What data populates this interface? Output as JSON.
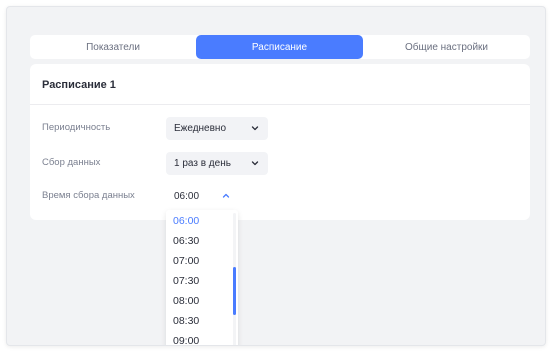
{
  "tabs": [
    {
      "label": "Показатели",
      "active": false
    },
    {
      "label": "Расписание",
      "active": true
    },
    {
      "label": "Общие настройки",
      "active": false
    }
  ],
  "card": {
    "title": "Расписание 1",
    "fields": [
      {
        "label": "Периодичность",
        "value": "Ежедневно",
        "chevron": "chevron-down-icon"
      },
      {
        "label": "Сбор данных",
        "value": "1 раз в день",
        "chevron": "chevron-down-icon"
      },
      {
        "label": "Время сбора данных",
        "value": "06:00",
        "chevron": "chevron-up-icon"
      }
    ]
  },
  "dropdown": {
    "options": [
      "06:00",
      "06:30",
      "07:00",
      "07:30",
      "08:00",
      "08:30",
      "09:00"
    ],
    "selected": "06:00"
  },
  "colors": {
    "accent": "#4a7cff",
    "background": "#f2f3f5",
    "card": "#ffffff",
    "text": "#2b2e3a",
    "muted": "#7b8090"
  }
}
